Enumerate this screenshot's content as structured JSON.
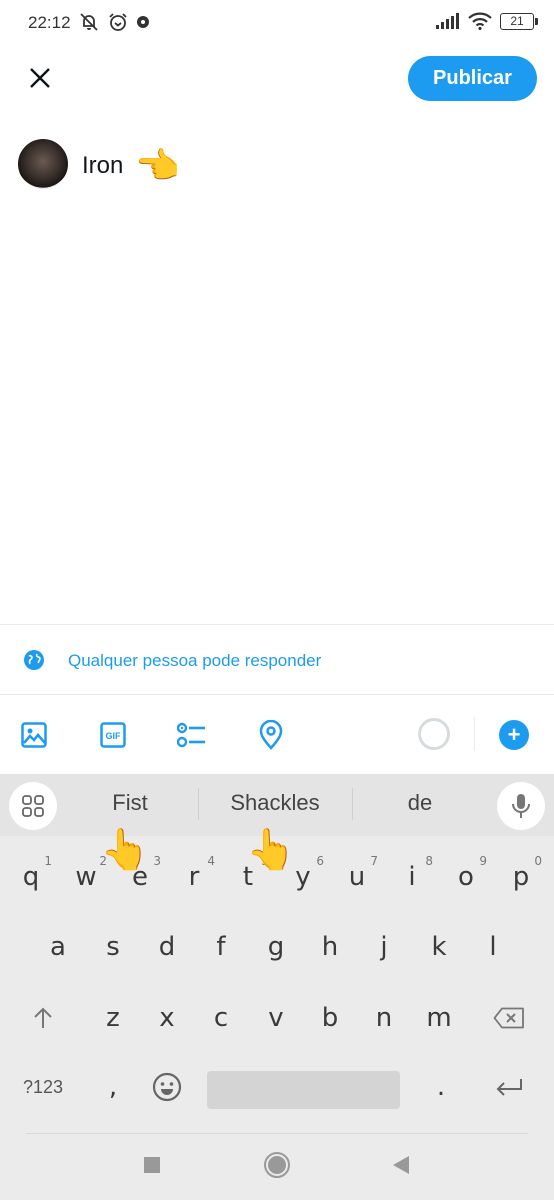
{
  "status_bar": {
    "time": "22:12",
    "left_icons": [
      "bell-off-icon",
      "alarm-icon",
      "notification-dot-icon"
    ],
    "right_icons": [
      "signal-icon",
      "wifi-icon",
      "battery-icon"
    ],
    "battery_level": "21"
  },
  "header": {
    "close_icon": "close-icon",
    "publish_label": "Publicar"
  },
  "compose": {
    "text": "Iron",
    "emoji": "👈",
    "avatar_alt": "user avatar"
  },
  "reply_setting": {
    "icon": "globe-icon",
    "label": "Qualquer pessoa pode responder"
  },
  "toolbar": {
    "icons": [
      "image-icon",
      "gif-icon",
      "poll-icon",
      "location-icon"
    ],
    "gif_label": "GIF",
    "add_label": "+"
  },
  "keyboard": {
    "suggestions": [
      "Fist",
      "Shackles",
      "de"
    ],
    "row1": [
      {
        "key": "q",
        "hint": "1"
      },
      {
        "key": "w",
        "hint": "2"
      },
      {
        "key": "e",
        "hint": "3"
      },
      {
        "key": "r",
        "hint": "4"
      },
      {
        "key": "t",
        "hint": "5"
      },
      {
        "key": "y",
        "hint": "6"
      },
      {
        "key": "u",
        "hint": "7"
      },
      {
        "key": "i",
        "hint": "8"
      },
      {
        "key": "o",
        "hint": "9"
      },
      {
        "key": "p",
        "hint": "0"
      }
    ],
    "row2": [
      "a",
      "s",
      "d",
      "f",
      "g",
      "h",
      "j",
      "k",
      "l"
    ],
    "row3": [
      "z",
      "x",
      "c",
      "v",
      "b",
      "n",
      "m"
    ],
    "symbols_label": "?123",
    "comma": ",",
    "period": ".",
    "overlay_emoji": "👆"
  },
  "nav_bar": {
    "buttons": [
      "recents-button",
      "home-button",
      "back-button"
    ]
  }
}
